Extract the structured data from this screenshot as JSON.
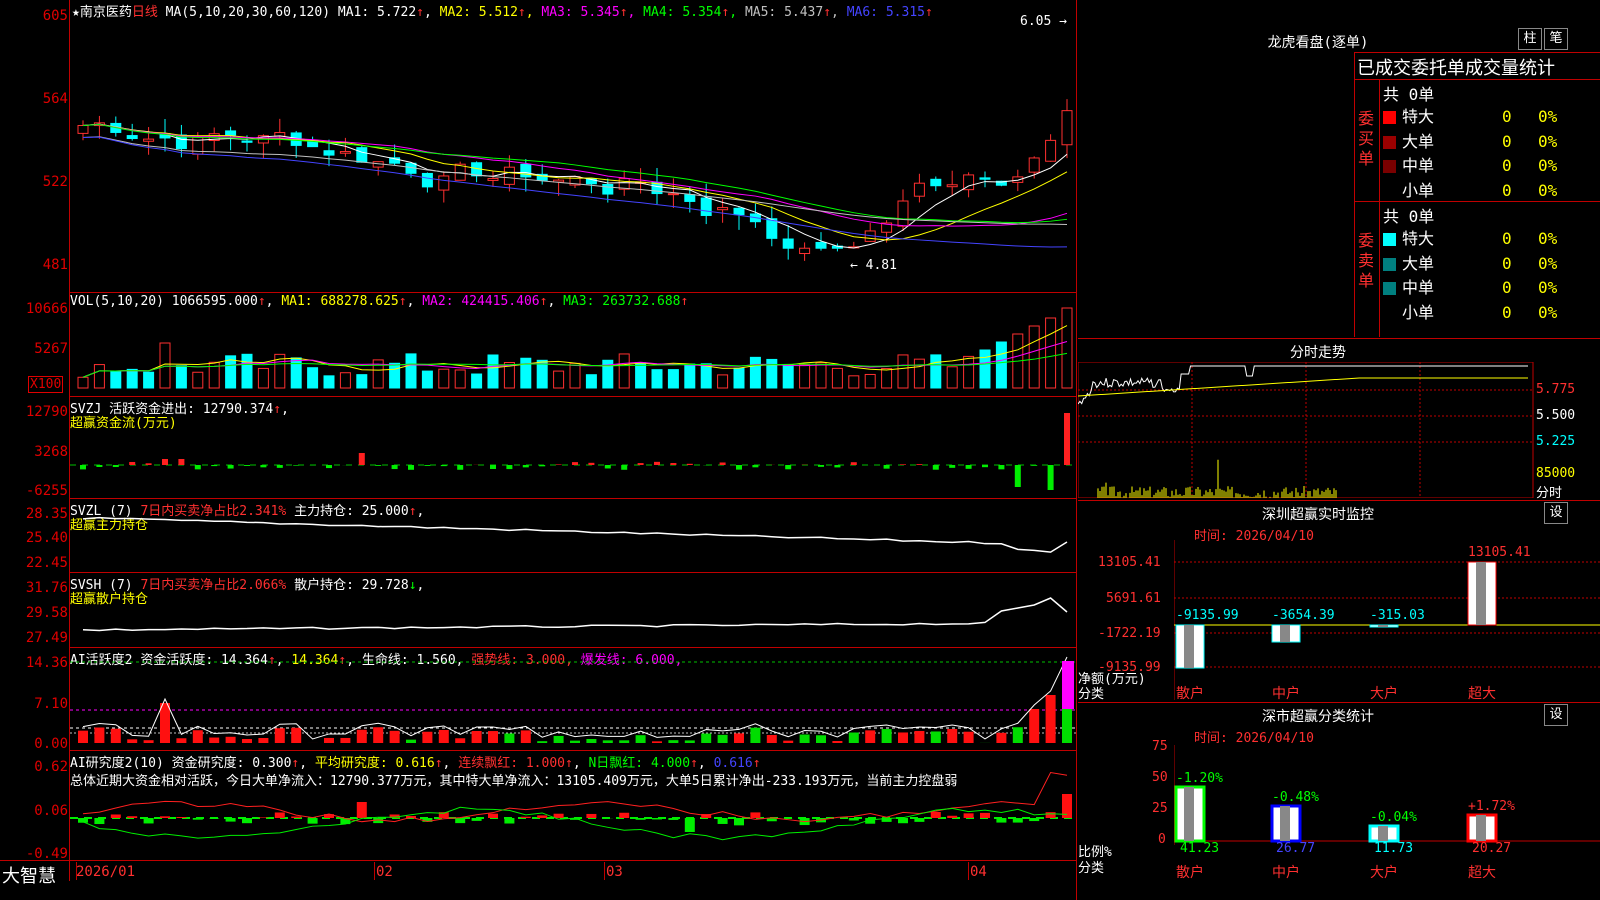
{
  "stock": {
    "name": "★南京医药",
    "period": "日线",
    "ma_label": "MA(5,10,20,30,60,120)",
    "mas": [
      {
        "name": "MA1:",
        "value": "5.722",
        "arrow": "↑"
      },
      {
        "name": "MA2:",
        "value": "5.512",
        "arrow": "↑"
      },
      {
        "name": "MA3:",
        "value": "5.345",
        "arrow": "↑"
      },
      {
        "name": "MA4:",
        "value": "5.354",
        "arrow": "↑"
      },
      {
        "name": "MA5:",
        "value": "5.437",
        "arrow": "↑"
      },
      {
        "name": "MA6:",
        "value": "5.315",
        "arrow": "↑"
      }
    ],
    "colors": {
      "ma1": "#ffffff",
      "ma2": "#ffff00",
      "ma3": "#ff00ff",
      "ma4": "#00ff00",
      "ma5": "#c0c0c0",
      "ma6": "#4444ff"
    }
  },
  "price_axis": [
    "605",
    "564",
    "522",
    "481"
  ],
  "price_markers": {
    "high": "6.05",
    "low": "4.81"
  },
  "vol": {
    "label": "VOL(5,10,20)",
    "value": "1066595.000",
    "ma1": "MA1: 688278.625",
    "ma2": "MA2: 424415.406",
    "ma3": "MA3: 263732.688",
    "axis": [
      "10666",
      "5267"
    ],
    "unit": "X100"
  },
  "svzj": {
    "title": "SVZJ",
    "desc": "活跃资金进出:",
    "value": "12790.374",
    "sub": "超赢资金流(万元)",
    "axis": [
      "12790",
      "3268",
      "-6255"
    ]
  },
  "svzl": {
    "title": "SVZL (7)",
    "desc": "7日内买卖净占比2.341%",
    "desc2": "主力持仓:",
    "value": "25.000",
    "sub": "超赢主力持仓",
    "axis": [
      "28.35",
      "25.40",
      "22.45"
    ]
  },
  "svsh": {
    "title": "SVSH (7)",
    "desc": "7日内买卖净占比2.066%",
    "desc2": "散户持仓:",
    "value": "29.728",
    "sub": "超赢散户持仓",
    "axis": [
      "31.76",
      "29.58",
      "27.49"
    ]
  },
  "ai1": {
    "title": "AI活跃度2",
    "desc": "资金活跃度:",
    "value": "14.364",
    "v2": "14.364",
    "life": "生命线: 1.560,",
    "strong": "强势线: 3.000,",
    "burst": "爆发线: 6.000,",
    "axis": [
      "14.36",
      "7.10",
      "0.00"
    ]
  },
  "ai2": {
    "title": "AI研究度2(10)",
    "desc": "资金研究度: 0.300",
    "avg": "平均研究度: 0.616",
    "red": "连续飘红: 1.000",
    "nred": "N日飘红: 4.000",
    "last": "0.616",
    "comment": "总体近期大资金相对活跃，今日大单净流入：12790.377万元，其中特大单净流入：13105.409万元，大单5日累计净出-233.193万元，当前主力控盘弱",
    "axis": [
      "0.62",
      "0.06",
      "-0.49"
    ]
  },
  "dates": [
    "2026/01",
    "02",
    "03",
    "04"
  ],
  "brand": "大智慧",
  "right": {
    "lhb_title": "龙虎看盘(逐单)",
    "btn1": "柱",
    "btn2": "笔",
    "order_title": "已成交委托单成交量统计",
    "buy_label": "委买单",
    "sell_label": "委卖单",
    "buy_total": "共 0单",
    "sell_total": "共 0单",
    "rows": [
      "特大",
      "大单",
      "中单",
      "小单"
    ],
    "zero": "0",
    "pct": "0%",
    "buy_colors": [
      "#ff0000",
      "#9a0000",
      "#7a0000",
      "#000000"
    ],
    "sell_colors": [
      "#00ffff",
      "#008080",
      "#008080",
      "#000000"
    ],
    "intraday_title": "分时走势",
    "intraday_axis": [
      "5.775",
      "5.500",
      "5.225",
      "85000",
      "分时"
    ],
    "sz_title": "深圳超赢实时监控",
    "sz_btn": "设",
    "sz_time": "时间: 2026/04/10",
    "sz_axis": [
      "13105.41",
      "5691.61",
      "-1722.19",
      "-9135.99"
    ],
    "sz_ylabel": "净额(万元)",
    "sz_yunit": "分类",
    "sz_vals": [
      "-9135.99",
      "-3654.39",
      "-315.03",
      "13105.41"
    ],
    "cats": [
      "散户",
      "中户",
      "大户",
      "超大"
    ],
    "cls_title": "深市超赢分类统计",
    "cls_btn": "设",
    "cls_time": "时间: 2026/04/10",
    "cls_axis": [
      "75",
      "50",
      "25",
      "0"
    ],
    "cls_ylabel": "比例%",
    "cls_yunit": "分类",
    "cls_top": [
      "-1.20%",
      "-0.48%",
      "-0.04%",
      "+1.72%"
    ],
    "cls_vals": [
      "41.23",
      "26.77",
      "11.73",
      "20.27"
    ]
  }
}
